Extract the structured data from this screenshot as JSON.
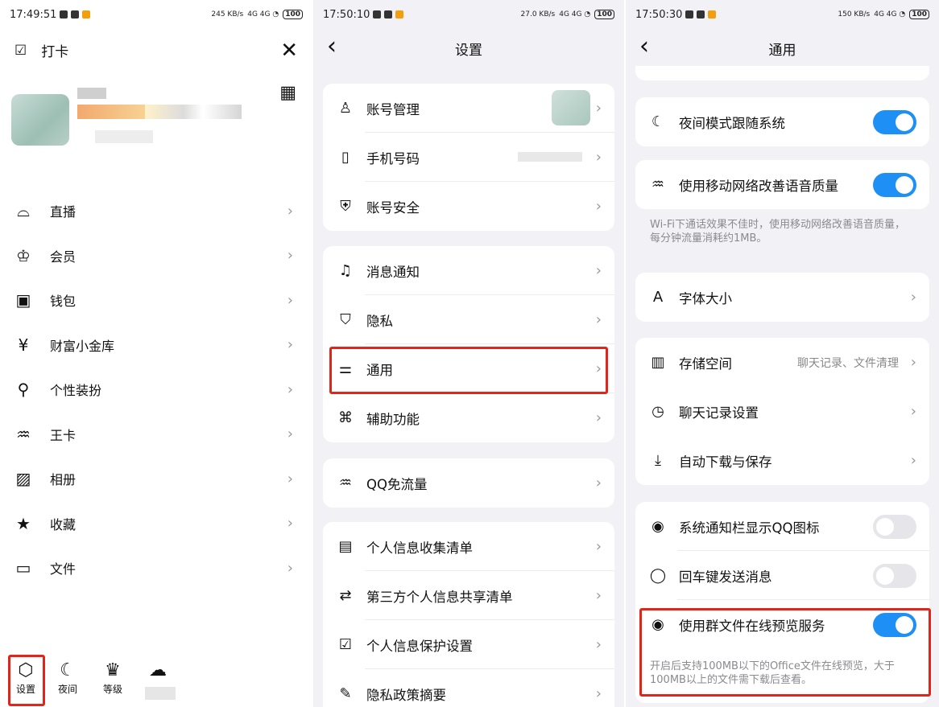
{
  "status_bar": [
    {
      "time": "17:49:51",
      "speed": "245 KB/s",
      "battery": "100"
    },
    {
      "time": "17:50:10",
      "speed": "27.0 KB/s",
      "battery": "100"
    },
    {
      "time": "17:50:30",
      "speed": "150 KB/s",
      "battery": "100"
    }
  ],
  "drawer": {
    "checkin_label": "打卡",
    "close_icon": "close-icon",
    "menu": [
      {
        "icon": "live-icon",
        "glyph": "⌓",
        "label": "直播"
      },
      {
        "icon": "crown-icon",
        "glyph": "♔",
        "label": "会员"
      },
      {
        "icon": "wallet-icon",
        "glyph": "▣",
        "label": "钱包"
      },
      {
        "icon": "moneybag-icon",
        "glyph": "¥",
        "label": "财富小金库"
      },
      {
        "icon": "shirt-icon",
        "glyph": "⚲",
        "label": "个性装扮"
      },
      {
        "icon": "antenna-icon",
        "glyph": "♒",
        "label": "王卡"
      },
      {
        "icon": "album-icon",
        "glyph": "▨",
        "label": "相册"
      },
      {
        "icon": "favorite-icon",
        "glyph": "★",
        "label": "收藏"
      },
      {
        "icon": "folder-icon",
        "glyph": "▭",
        "label": "文件"
      }
    ],
    "bottom": [
      {
        "icon": "settings-icon",
        "glyph": "⬡",
        "label": "设置"
      },
      {
        "icon": "moon-icon",
        "glyph": "☾",
        "label": "夜间"
      },
      {
        "icon": "trophy-icon",
        "glyph": "♛",
        "label": "等级"
      },
      {
        "icon": "weather-icon",
        "glyph": "☁",
        "label": ""
      }
    ]
  },
  "settings": {
    "title": "设置",
    "groups": [
      [
        {
          "icon": "account-icon",
          "glyph": "♙",
          "label": "账号管理"
        },
        {
          "icon": "phone-icon",
          "glyph": "▯",
          "label": "手机号码"
        },
        {
          "icon": "shield-icon",
          "glyph": "⛨",
          "label": "账号安全"
        }
      ],
      [
        {
          "icon": "bell-icon",
          "glyph": "♫",
          "label": "消息通知"
        },
        {
          "icon": "privacy-icon",
          "glyph": "⛉",
          "label": "隐私"
        },
        {
          "icon": "sliders-icon",
          "glyph": "⚌",
          "label": "通用"
        },
        {
          "icon": "accessibility-icon",
          "glyph": "⌘",
          "label": "辅助功能"
        }
      ],
      [
        {
          "icon": "antenna-icon",
          "glyph": "♒",
          "label": "QQ免流量"
        }
      ],
      [
        {
          "icon": "document-icon",
          "glyph": "▤",
          "label": "个人信息收集清单"
        },
        {
          "icon": "share-icon",
          "glyph": "⇄",
          "label": "第三方个人信息共享清单"
        },
        {
          "icon": "protect-icon",
          "glyph": "☑",
          "label": "个人信息保护设置"
        },
        {
          "icon": "edit-icon",
          "glyph": "✎",
          "label": "隐私政策摘要"
        }
      ]
    ]
  },
  "general": {
    "title": "通用",
    "night_mode": {
      "icon": "moon-icon",
      "glyph": "☾",
      "label": "夜间模式跟随系统",
      "on": true
    },
    "mobile_voice": {
      "icon": "antenna-icon",
      "glyph": "♒",
      "label": "使用移动网络改善语音质量",
      "on": true
    },
    "mobile_voice_note": "Wi-Fi下通话效果不佳时，使用移动网络改善语音质量，每分钟流量消耗约1MB。",
    "font_size": {
      "icon": "font-icon",
      "glyph": "A",
      "label": "字体大小"
    },
    "storage": [
      {
        "icon": "storage-icon",
        "glyph": "▥",
        "label": "存储空间",
        "value": "聊天记录、文件清理"
      },
      {
        "icon": "clock-icon",
        "glyph": "◷",
        "label": "聊天记录设置",
        "value": ""
      },
      {
        "icon": "download-icon",
        "glyph": "⤓",
        "label": "自动下载与保存",
        "value": ""
      }
    ],
    "toggles": [
      {
        "icon": "eye-icon",
        "glyph": "◉",
        "label": "系统通知栏显示QQ图标",
        "on": false
      },
      {
        "icon": "chat-icon",
        "glyph": "◯",
        "label": "回车键发送消息",
        "on": false
      },
      {
        "icon": "eye-icon",
        "glyph": "◉",
        "label": "使用群文件在线预览服务",
        "on": true
      }
    ],
    "preview_note": "开启后支持100MB以下的Office文件在线预览，大于100MB以上的文件需下载后查看。"
  }
}
